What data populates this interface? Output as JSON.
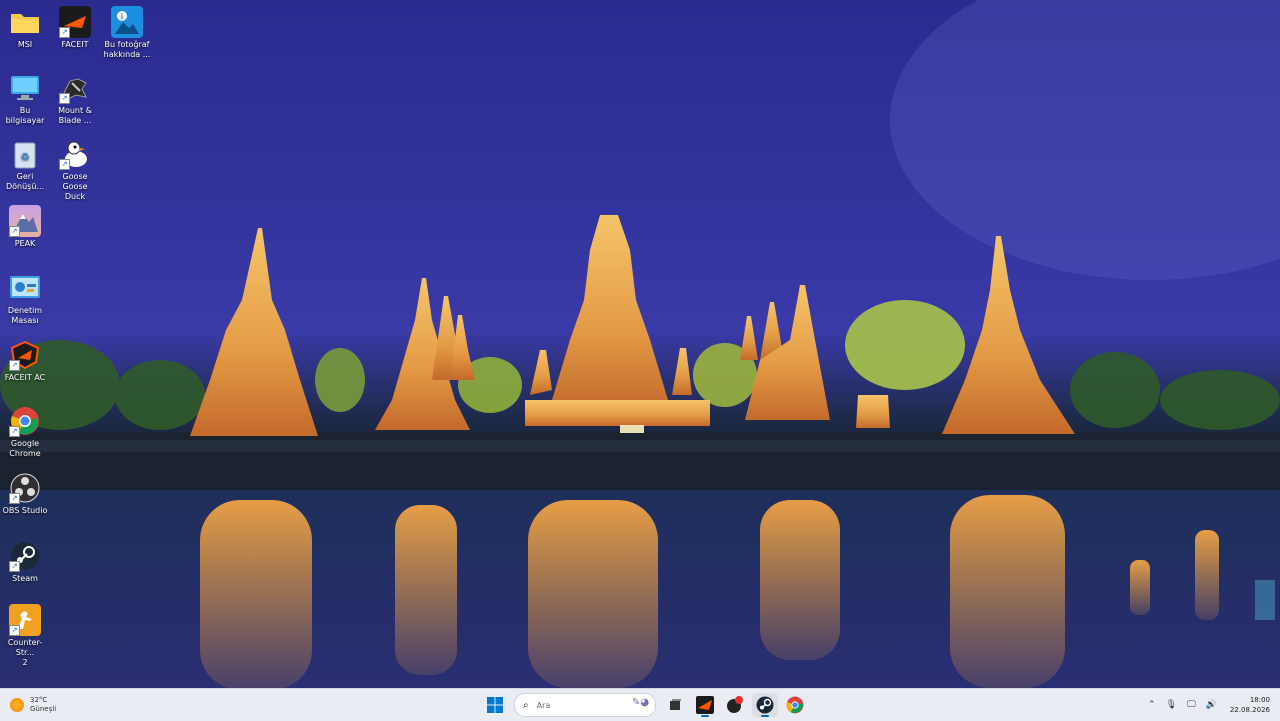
{
  "desktop": {
    "icons": [
      {
        "label": "MSI",
        "icon": "folder-icon"
      },
      {
        "label": "FACEIT",
        "icon": "faceit-icon"
      },
      {
        "label": "Bu fotoğraf\nhakkında ...",
        "icon": "photo-info-icon"
      },
      {
        "label": "Bu bilgisayar",
        "icon": "computer-icon"
      },
      {
        "label": "Mount &\nBlade ...",
        "icon": "mount-blade-icon"
      },
      {
        "label": "Geri\nDönüşü...",
        "icon": "recycle-bin-icon"
      },
      {
        "label": "Goose Goose\nDuck",
        "icon": "goose-goose-duck-icon"
      },
      {
        "label": "PEAK",
        "icon": "peak-icon"
      },
      {
        "label": "Denetim\nMasası",
        "icon": "control-panel-icon"
      },
      {
        "label": "FACEIT AC",
        "icon": "faceit-ac-icon"
      },
      {
        "label": "Google\nChrome",
        "icon": "chrome-icon"
      },
      {
        "label": "OBS Studio",
        "icon": "obs-icon"
      },
      {
        "label": "Steam",
        "icon": "steam-icon"
      },
      {
        "label": "Counter-Str...\n2",
        "icon": "counter-strike-icon"
      }
    ]
  },
  "taskbar": {
    "weather": {
      "temp": "32°C",
      "condition": "Güneşli",
      "icon": "sun-icon"
    },
    "search_placeholder": "Ara",
    "apps": [
      "windows-start-icon",
      "task-view-icon",
      "faceit-icon",
      "app-icon",
      "steam-icon",
      "chrome-icon"
    ],
    "tray": {
      "time": "18:00",
      "date": "22.08.2026"
    }
  },
  "colors": {
    "sky_top": "#2a2a8f",
    "sky_bottom": "#3a3aa8",
    "temple_gold": "#e8a046",
    "taskbar_bg": "#e9ecf2",
    "accent": "#0067c0"
  }
}
